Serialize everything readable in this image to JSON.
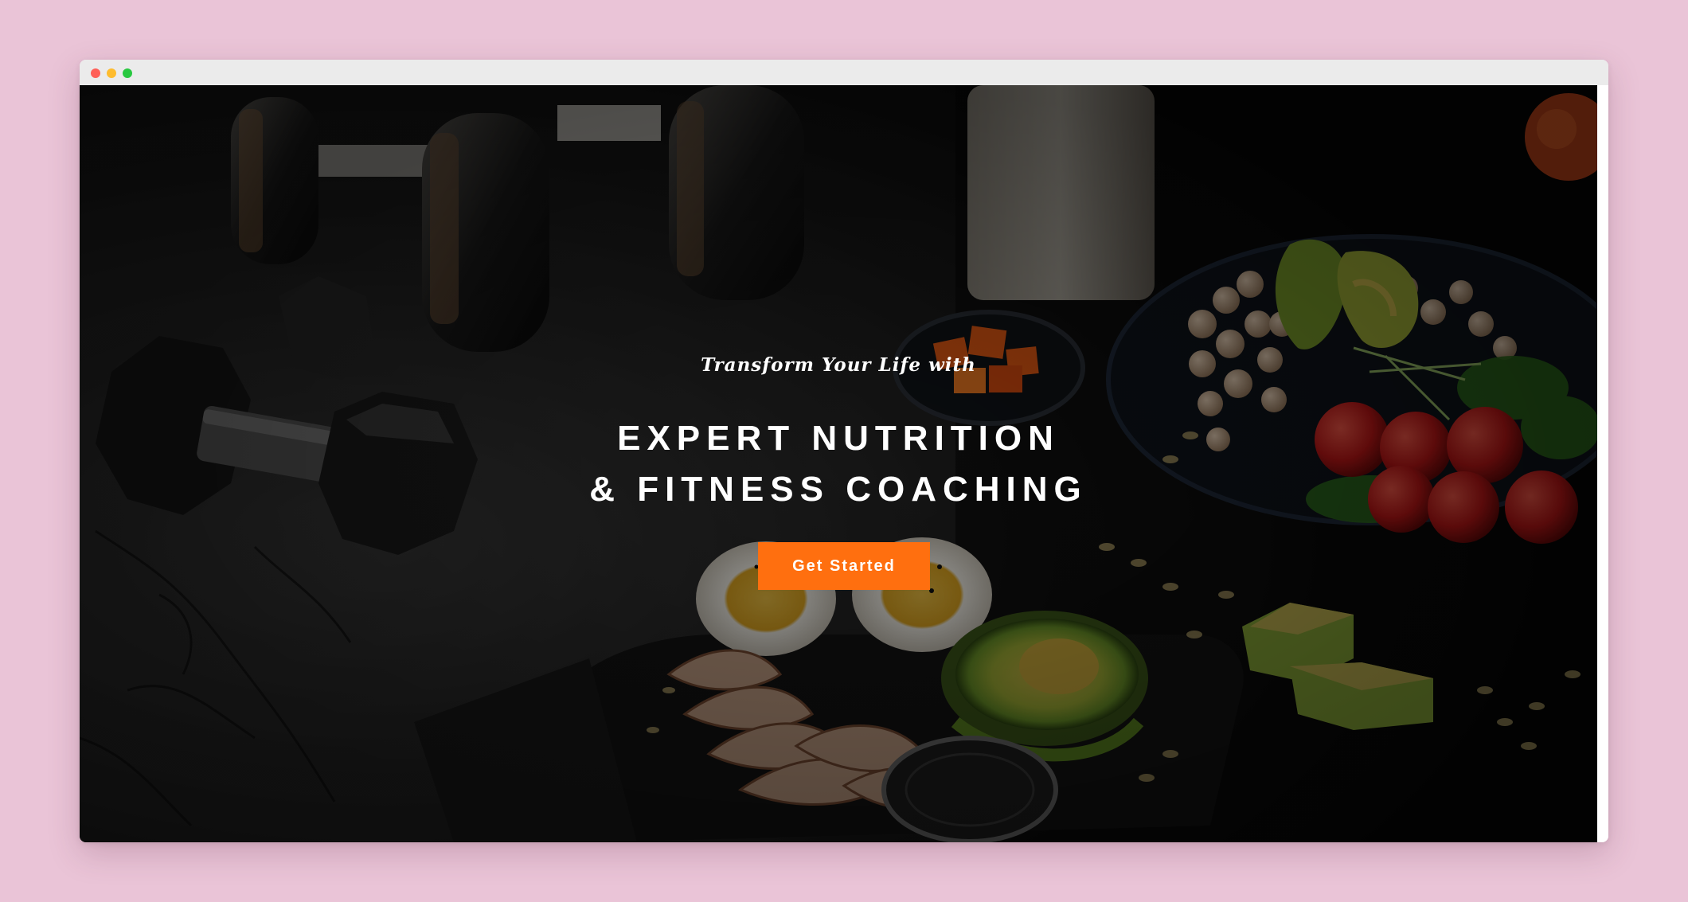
{
  "hero": {
    "tagline": "Transform Your Life with",
    "heading_line1": "EXPERT NUTRITION",
    "heading_line2": "& FITNESS COACHING",
    "cta_label": "Get Started"
  },
  "colors": {
    "page_background": "#eac4d7",
    "accent": "#ff6f0f",
    "hero_text": "#ffffff",
    "title_bar": "#ebebeb"
  },
  "icons": {
    "window_controls": [
      "close-dot",
      "minimize-dot",
      "maximize-dot"
    ]
  }
}
